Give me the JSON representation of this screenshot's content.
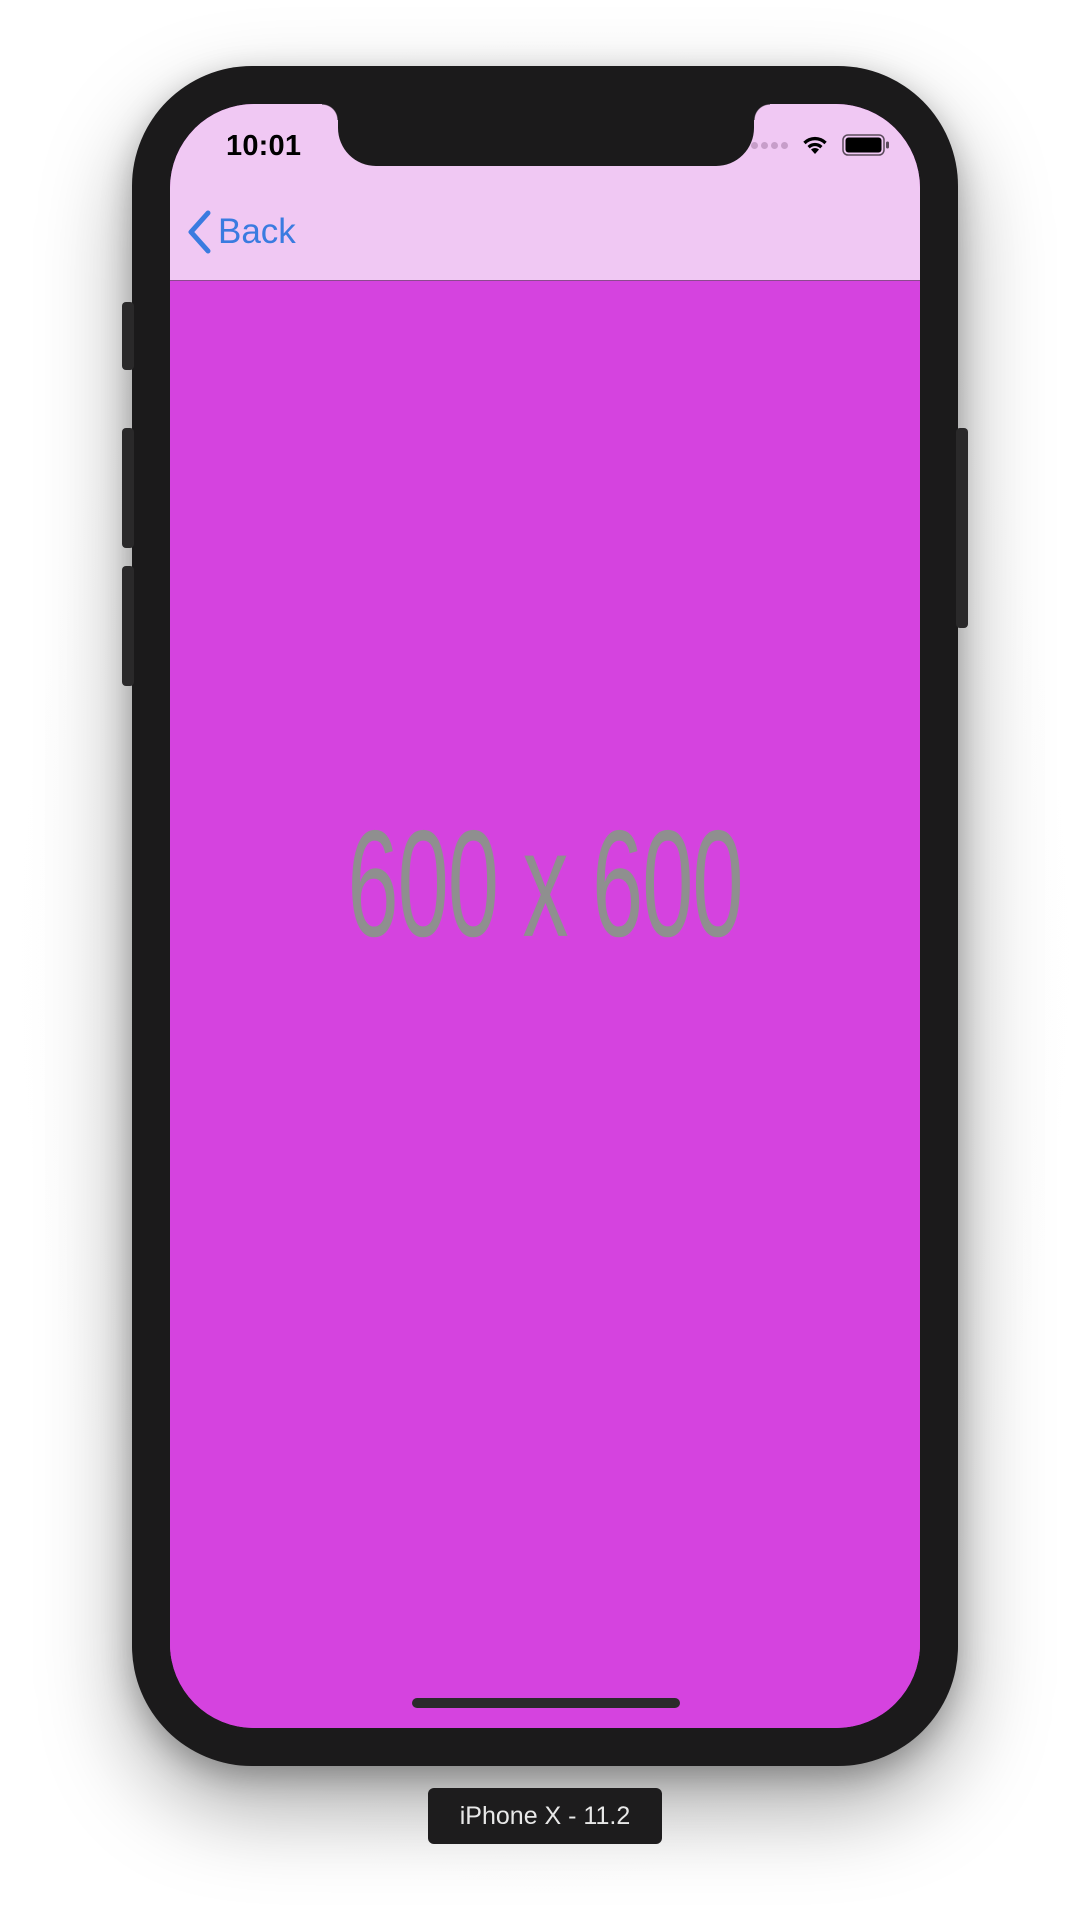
{
  "status_bar": {
    "time": "10:01",
    "icons": [
      "cellular-signal-icon",
      "wifi-icon",
      "battery-icon"
    ]
  },
  "nav_bar": {
    "back_label": "Back",
    "back_icon": "chevron-left-icon",
    "background_color": "#f0c8f3",
    "tint_color": "#3a7be0"
  },
  "content": {
    "placeholder_text": "600 x 600",
    "background_color": "#d543df"
  },
  "device_label": "iPhone X - 11.2"
}
